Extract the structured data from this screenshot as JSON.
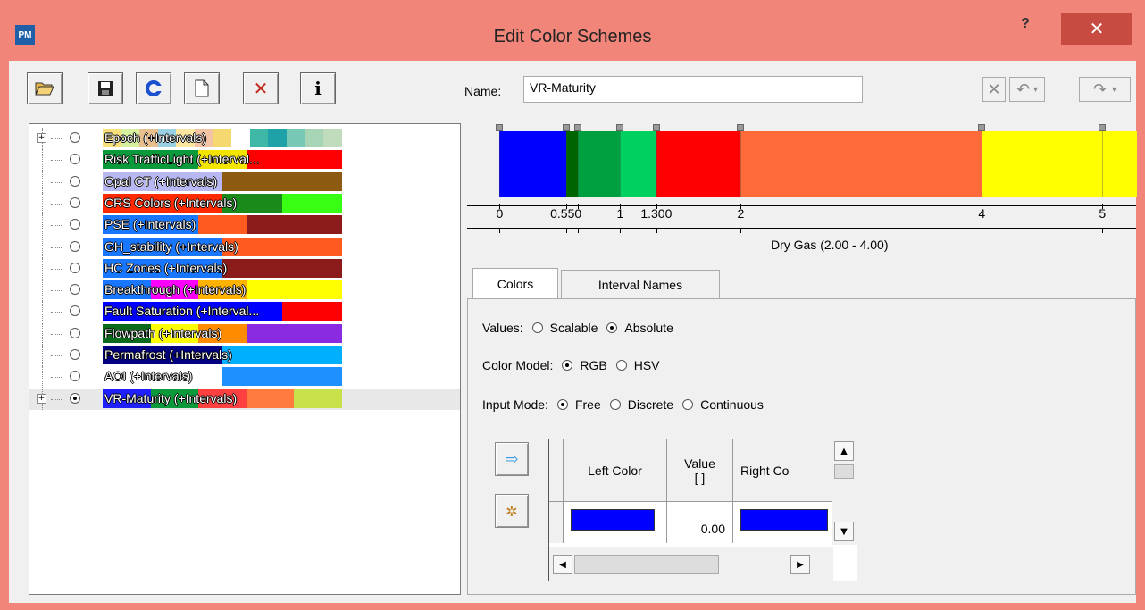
{
  "window": {
    "title": "Edit Color Schemes",
    "app_icon_text": "PM",
    "help_label": "?",
    "close_label": "✕"
  },
  "toolbar": {
    "open": "folder-open-icon",
    "save": "save-icon",
    "refresh": "refresh-icon",
    "new": "new-document-icon",
    "delete": "delete-icon",
    "info": "info-icon",
    "info_label": "i",
    "delete_label": "✕"
  },
  "schemes": [
    {
      "label": "Epoch (+Intervals)",
      "checked": false,
      "expandable": true,
      "colors": [
        "#f7e07a",
        "#d7f0a0",
        "#e8c08f",
        "#9ad0e4",
        "#fce6a0",
        "#f4c3a3",
        "#f5d870",
        "#ffffff",
        "#3fb7a7",
        "#1fa1a8",
        "#77c8b4",
        "#a7d4b4",
        "#c0dcbc"
      ]
    },
    {
      "label": "Risk TrafficLight (+Interval...",
      "checked": false,
      "expandable": false,
      "colors": [
        "#0b9a3b",
        "#0b9a3b",
        "#f4e500",
        "#ff0000",
        "#ff0000"
      ]
    },
    {
      "label": "Opal CT (+Intervals)",
      "checked": false,
      "expandable": false,
      "colors": [
        "#b7b7f2",
        "#b7b7f2",
        "#8c5a10",
        "#8c5a10"
      ]
    },
    {
      "label": "CRS Colors (+Intervals)",
      "checked": false,
      "expandable": false,
      "colors": [
        "#ff2a00",
        "#ff2a00",
        "#1a8a1a",
        "#39ff14"
      ]
    },
    {
      "label": "PSE (+Intervals)",
      "checked": false,
      "expandable": false,
      "colors": [
        "#1976ff",
        "#1976ff",
        "#ff5a1f",
        "#8b1a1a",
        "#8b1a1a"
      ]
    },
    {
      "label": "GH_stability (+Intervals)",
      "checked": false,
      "expandable": false,
      "colors": [
        "#1976ff",
        "#1976ff",
        "#ff5a1f",
        "#ff5a1f"
      ]
    },
    {
      "label": "HC Zones (+Intervals)",
      "checked": false,
      "expandable": false,
      "colors": [
        "#1976ff",
        "#1976ff",
        "#8b1a1a",
        "#8b1a1a"
      ]
    },
    {
      "label": "Breakthrough (+Intervals)",
      "checked": false,
      "expandable": false,
      "colors": [
        "#1976ff",
        "#ff00ff",
        "#ffb300",
        "#ffff00",
        "#ffff00"
      ]
    },
    {
      "label": "Fault Saturation (+Interval...",
      "checked": false,
      "expandable": false,
      "colors": [
        "#0000ff",
        "#0000ff",
        "#0000ff",
        "#ff0000"
      ]
    },
    {
      "label": "Flowpath (+Intervals)",
      "checked": false,
      "expandable": false,
      "colors": [
        "#0b6a1b",
        "#ffff00",
        "#ff8c00",
        "#8a2be2",
        "#8a2be2"
      ]
    },
    {
      "label": "Permafrost (+Intervals)",
      "checked": false,
      "expandable": false,
      "colors": [
        "#000080",
        "#000080",
        "#00b0ff",
        "#00b0ff"
      ]
    },
    {
      "label": "AOI (+Intervals)",
      "checked": false,
      "expandable": false,
      "colors": [
        "#ffffff",
        "#ffffff",
        "#1e90ff",
        "#1e90ff"
      ]
    },
    {
      "label": "VR-Maturity (+Intervals)",
      "checked": true,
      "expandable": true,
      "colors": [
        "#2020ff",
        "#0b9a3b",
        "#ff4040",
        "#ff7a3d",
        "#c8e04a"
      ]
    }
  ],
  "editor": {
    "name_label": "Name:",
    "name_value": "VR-Maturity",
    "tools": {
      "clear": "clear-icon",
      "undo": "undo-icon",
      "redo": "redo-icon"
    },
    "tools_labels": {
      "clear": "✕",
      "undo": "↶",
      "undo_drop": "▾",
      "redo": "↷",
      "redo_drop": "▾"
    },
    "segments": [
      {
        "from": 0,
        "to": 0.55,
        "color": "#0000ff"
      },
      {
        "from": 0.55,
        "to": 0.65,
        "color": "#006400"
      },
      {
        "from": 0.65,
        "to": 1.0,
        "color": "#00a040"
      },
      {
        "from": 1.0,
        "to": 1.3,
        "color": "#00d060"
      },
      {
        "from": 1.3,
        "to": 2.0,
        "color": "#ff0000"
      },
      {
        "from": 2.0,
        "to": 4.0,
        "color": "#ff6a3a"
      },
      {
        "from": 4.0,
        "to": 5.0,
        "color": "#ffff00"
      },
      {
        "from": 5.0,
        "to": 5.3,
        "color": "#ffff00"
      }
    ],
    "markers": [
      0,
      0.55,
      0.65,
      1.0,
      1.3,
      2.0,
      4.0,
      5.0
    ],
    "axis_min": -0.27,
    "axis_max": 5.28,
    "tick_labels": [
      {
        "value": 0,
        "text": "0"
      },
      {
        "value": 0.55,
        "text": "0.550"
      },
      {
        "value": 1.0,
        "text": "1"
      },
      {
        "value": 1.3,
        "text": "1.300"
      },
      {
        "value": 2.0,
        "text": "2"
      },
      {
        "value": 4.0,
        "text": "4"
      },
      {
        "value": 5.0,
        "text": "5"
      }
    ],
    "range_label": "Dry Gas (2.00 - 4.00)"
  },
  "tabs": [
    {
      "label": "Colors",
      "active": true
    },
    {
      "label": "Interval Names",
      "active": false
    }
  ],
  "options": {
    "values": {
      "label": "Values:",
      "items": [
        {
          "label": "Scalable",
          "checked": false
        },
        {
          "label": "Absolute",
          "checked": true
        }
      ]
    },
    "color_model": {
      "label": "Color Model:",
      "items": [
        {
          "label": "RGB",
          "checked": true
        },
        {
          "label": "HSV",
          "checked": false
        }
      ]
    },
    "input_mode": {
      "label": "Input Mode:",
      "items": [
        {
          "label": "Free",
          "checked": true
        },
        {
          "label": "Discrete",
          "checked": false
        },
        {
          "label": "Continuous",
          "checked": false
        }
      ]
    }
  },
  "grid": {
    "headers": [
      "Left Color",
      "Value\n[ ]",
      "Right Co"
    ],
    "rows": [
      {
        "left_color": "#0000ff",
        "value": "0.00",
        "right_color": "#0000ff"
      }
    ]
  },
  "side_buttons": {
    "apply": "arrow-right-icon",
    "sparkle": "color-picker-icon",
    "apply_label": "⇨",
    "sparkle_label": "✲"
  }
}
